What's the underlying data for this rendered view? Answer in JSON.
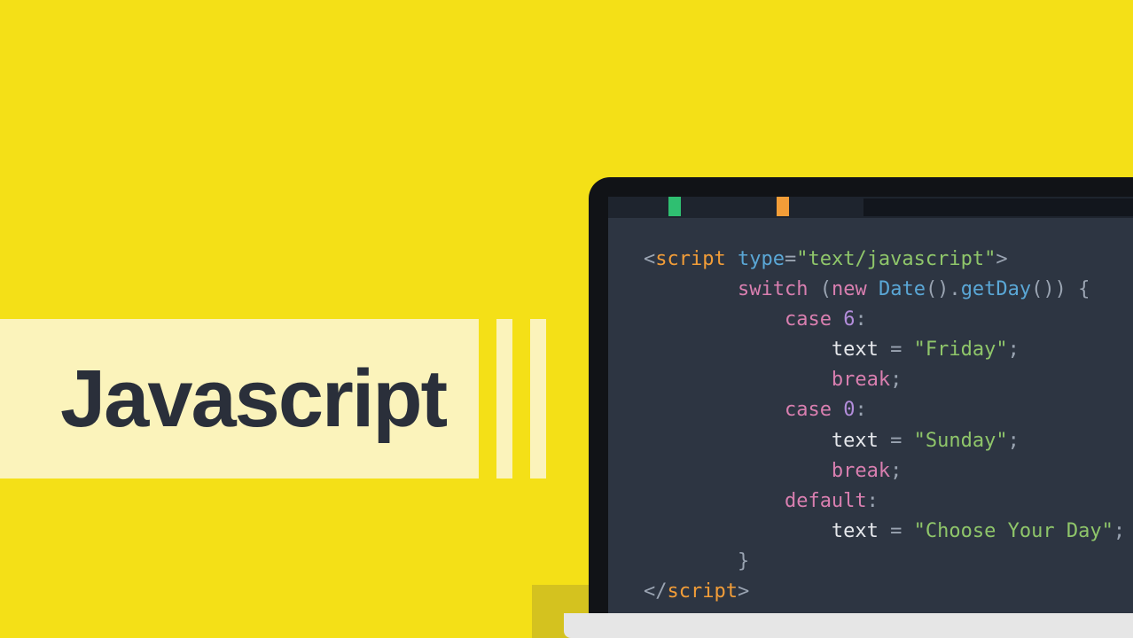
{
  "title": "Javascript",
  "code": {
    "line1": {
      "open_bracket": "<",
      "tag": "script",
      "sp": " ",
      "attr": "type",
      "eq": "=",
      "val": "\"text/javascript\"",
      "close_bracket": ">"
    },
    "line2": {
      "indent": "        ",
      "kw": "switch",
      "sp": " ",
      "p1": "(",
      "kw2": "new",
      "sp2": " ",
      "cls": "Date",
      "call": "().",
      "meth": "getDay",
      "p2": "()) {"
    },
    "line3": {
      "indent": "            ",
      "kw": "case",
      "sp": " ",
      "num": "6",
      "colon": ":"
    },
    "line4": {
      "indent": "                ",
      "var": "text",
      "sp": " ",
      "eq": "=",
      "sp2": " ",
      "str": "\"Friday\"",
      "semi": ";"
    },
    "line5": {
      "indent": "                ",
      "kw": "break",
      "semi": ";"
    },
    "line6": {
      "indent": "            ",
      "kw": "case",
      "sp": " ",
      "num": "0",
      "colon": ":"
    },
    "line7": {
      "indent": "                ",
      "var": "text",
      "sp": " ",
      "eq": "=",
      "sp2": " ",
      "str": "\"Sunday\"",
      "semi": ";"
    },
    "line8": {
      "indent": "                ",
      "kw": "break",
      "semi": ";"
    },
    "line9": {
      "indent": "            ",
      "kw": "default",
      "colon": ":"
    },
    "line10": {
      "indent": "                ",
      "var": "text",
      "sp": " ",
      "eq": "=",
      "sp2": " ",
      "str": "\"Choose Your Day\"",
      "semi": ";"
    },
    "line11": {
      "indent": "        ",
      "brace": "}"
    },
    "line12": {
      "open": "</",
      "tag": "script",
      "close": ">"
    }
  }
}
